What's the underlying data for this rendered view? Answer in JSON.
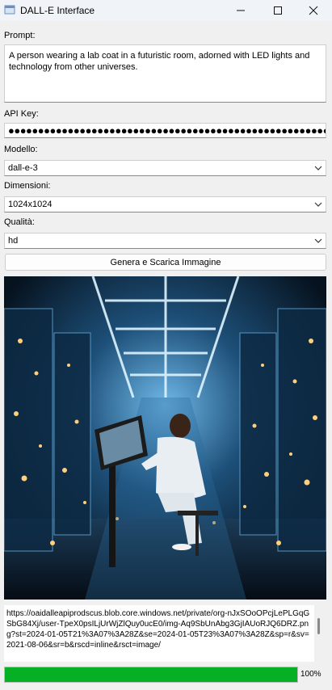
{
  "window": {
    "title": "DALL-E Interface"
  },
  "form": {
    "prompt_label": "Prompt:",
    "prompt_value": "A person wearing a lab coat in a futuristic room, adorned with LED lights and technology from other universes.",
    "api_key_label": "API Key:",
    "api_key_value": "●●●●●●●●●●●●●●●●●●●●●●●●●●●●●●●●●●●●●●●●●●●●●●●●●●●●●●●●",
    "model_label": "Modello:",
    "model_value": "dall-e-3",
    "size_label": "Dimensioni:",
    "size_value": "1024x1024",
    "quality_label": "Qualità:",
    "quality_value": "hd",
    "generate_button": "Genera e Scarica Immagine"
  },
  "result": {
    "url": "https://oaidalleapiprodscus.blob.core.windows.net/private/org-nJxSOoOPcjLePLGqGSbG84Xj/user-TpeX0psILjUrWjZlQuy0ucE0/img-Aq9SbUnAbg3GjIAUoRJQ6DRZ.png?st=2024-01-05T21%3A07%3A28Z&se=2024-01-05T23%3A07%3A28Z&sp=r&sv=2021-08-06&sr=b&rscd=inline&rsct=image/",
    "progress_percent": 100,
    "progress_label": "100%"
  },
  "colors": {
    "progress": "#06b025",
    "titlebar": "#f0f4f9"
  }
}
